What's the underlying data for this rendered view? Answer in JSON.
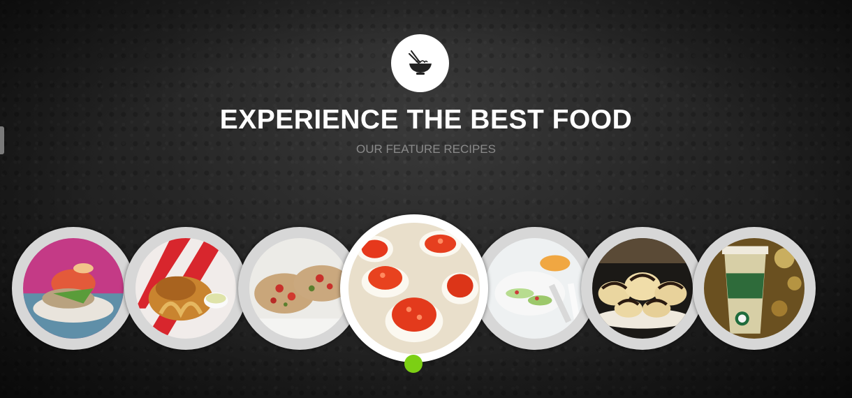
{
  "header": {
    "logo_icon": "bowl-with-chopsticks-icon",
    "title": "EXPERIENCE THE BEST FOOD",
    "subtitle": "OUR FEATURE RECIPES"
  },
  "carousel": {
    "active_index": 3,
    "accent_color": "#7ccf14",
    "items": [
      {
        "name": "recipe-seafood-tower"
      },
      {
        "name": "recipe-fried-clams-fries"
      },
      {
        "name": "recipe-bruschetta"
      },
      {
        "name": "recipe-caviar-eggs"
      },
      {
        "name": "recipe-avocado-shrimp"
      },
      {
        "name": "recipe-chocolate-pastries"
      },
      {
        "name": "recipe-coffee-cup"
      }
    ]
  }
}
